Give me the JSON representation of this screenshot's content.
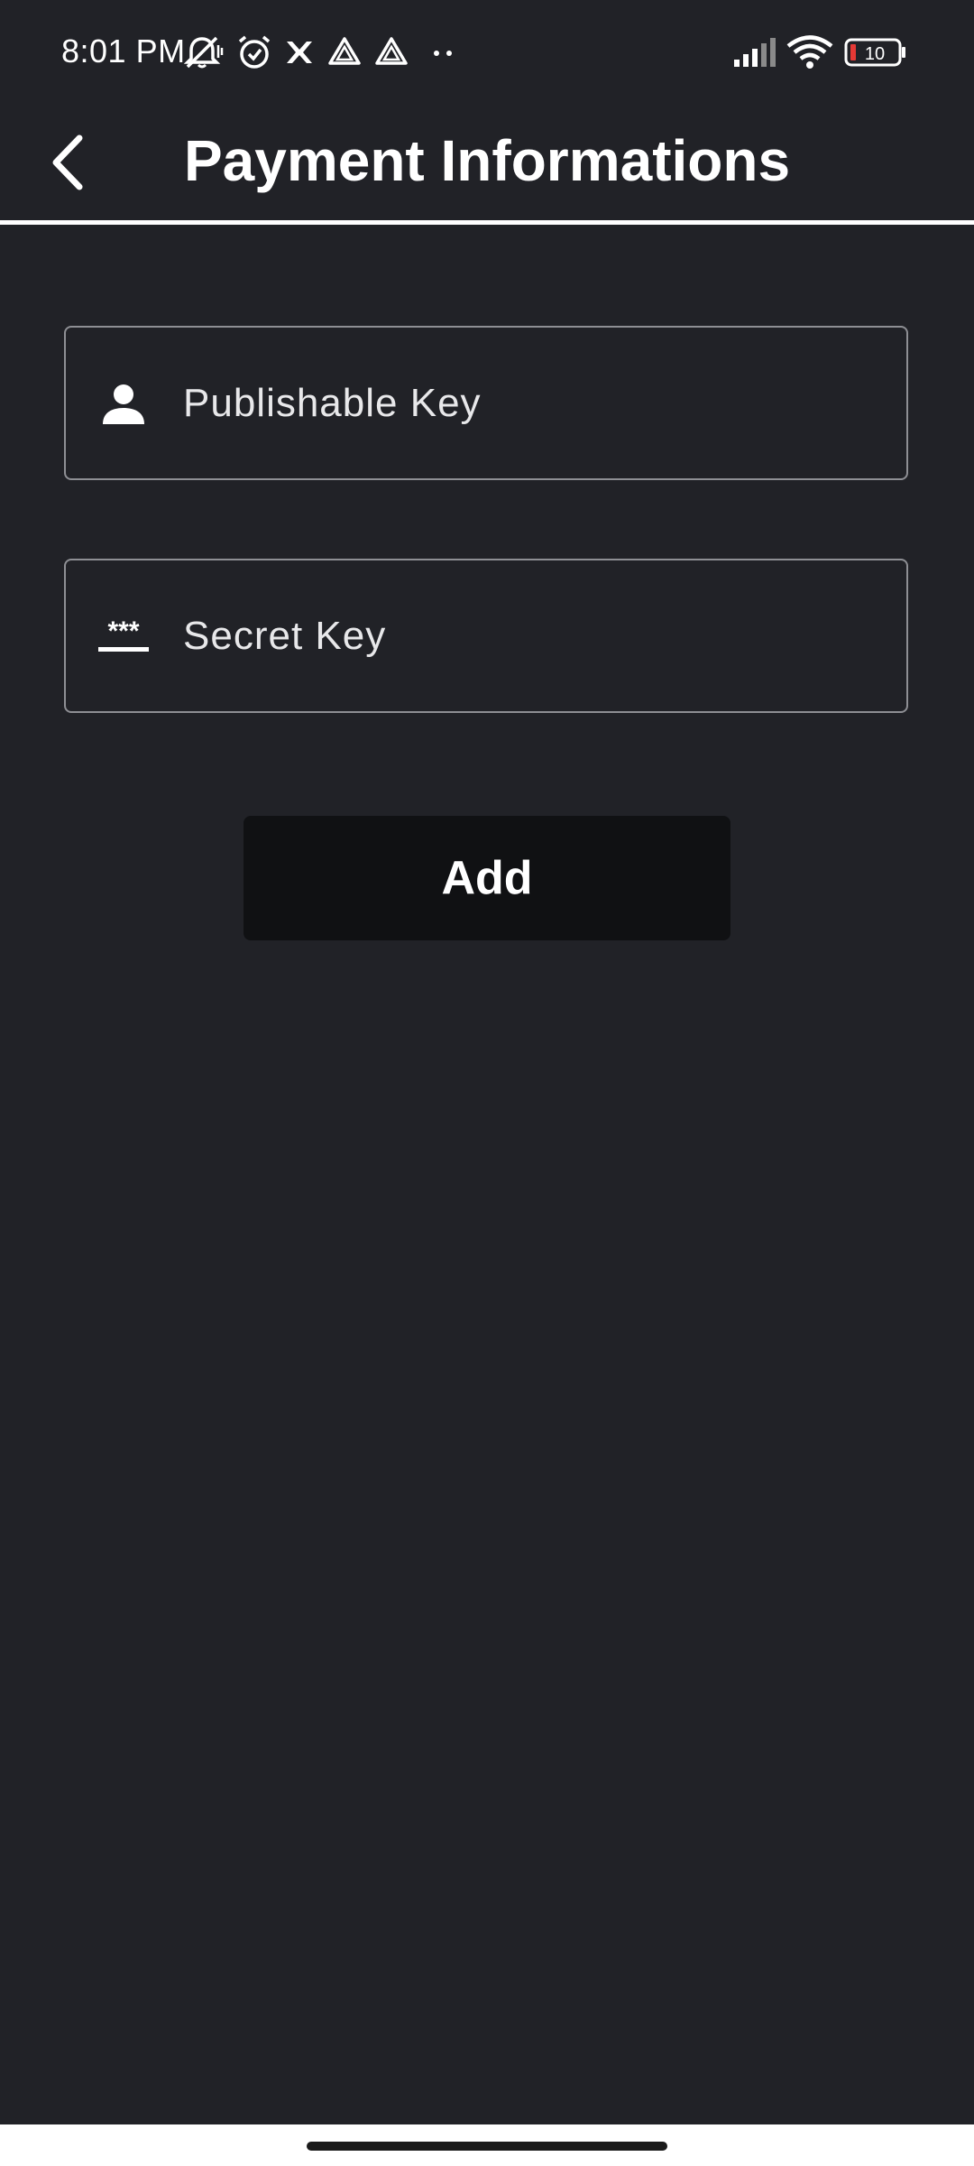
{
  "status_bar": {
    "time": "8:01 PM",
    "battery_level": "10",
    "icons": [
      "mute-icon",
      "alarm-icon",
      "app-x-icon",
      "drive-icon",
      "drive-icon",
      "more-dots-icon",
      "signal-icon",
      "wifi-icon",
      "battery-icon"
    ],
    "battery_low_color": "#e53935"
  },
  "header": {
    "title": "Payment Informations",
    "back_icon": "chevron-left-icon"
  },
  "form": {
    "publishable_key": {
      "placeholder": "Publishable Key",
      "value": "",
      "icon": "person-icon"
    },
    "secret_key": {
      "placeholder": "Secret Key",
      "value": "",
      "icon": "password-icon"
    }
  },
  "actions": {
    "add_label": "Add"
  },
  "colors": {
    "background": "#212227",
    "field_border": "#8e8f94",
    "button_background": "#101113",
    "text": "#ffffff"
  }
}
